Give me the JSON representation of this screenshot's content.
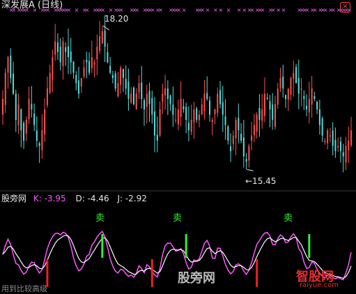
{
  "header": {
    "title": "深发展A (日线)"
  },
  "price_chart": {
    "high_label": "18.20",
    "low_label": "←15.45"
  },
  "indicator": {
    "name": "股旁网",
    "k": "K: -3.95",
    "d": "D: -4.46",
    "j": "J: -2.92",
    "sell_label": "卖"
  },
  "watermarks": {
    "center_text": "股旁网",
    "bottom_text": "用到比较高级",
    "logo_text": "智股网",
    "logo_url": "raiyue.com"
  },
  "colors": {
    "up": "#ff5050",
    "down": "#55dddd",
    "k_line": "#ff55ff",
    "d_line": "#ffffff",
    "sell_signal": "#33ee33",
    "buy_signal": "#ee2020",
    "marker": "#ff66ff"
  },
  "chart_data": [
    {
      "type": "candlestick",
      "title": "深发展A (日线)",
      "ylim": [
        15.2,
        18.4
      ],
      "annotations": [
        {
          "label": "18.20",
          "bar": 38,
          "value": 18.2
        },
        {
          "label": "15.45",
          "bar": 93,
          "value": 15.45
        }
      ],
      "closes": [
        16.8,
        17.3,
        17.6,
        17.2,
        16.9,
        16.4,
        16.7,
        16.2,
        16.0,
        16.4,
        16.8,
        16.6,
        16.3,
        16.0,
        15.9,
        16.2,
        16.6,
        17.0,
        17.3,
        17.6,
        17.9,
        17.7,
        17.5,
        17.9,
        17.7,
        17.6,
        17.5,
        17.3,
        17.1,
        16.9,
        17.2,
        17.4,
        17.5,
        17.3,
        17.6,
        17.5,
        17.8,
        18.0,
        18.1,
        17.8,
        17.5,
        17.3,
        17.2,
        17.0,
        17.1,
        17.4,
        17.2,
        17.0,
        16.8,
        16.9,
        16.7,
        16.9,
        17.1,
        16.8,
        16.6,
        16.9,
        16.7,
        16.5,
        16.1,
        16.0,
        16.6,
        16.9,
        17.0,
        16.8,
        16.7,
        16.5,
        16.4,
        16.6,
        16.8,
        16.6,
        16.4,
        16.2,
        16.4,
        16.6,
        16.4,
        16.5,
        16.7,
        16.9,
        16.8,
        16.5,
        16.4,
        16.6,
        16.9,
        16.7,
        16.5,
        16.3,
        16.0,
        15.8,
        16.1,
        16.4,
        16.2,
        16.0,
        15.7,
        15.6,
        15.9,
        16.1,
        16.3,
        16.5,
        16.4,
        16.6,
        16.9,
        16.8,
        16.6,
        16.4,
        16.7,
        17.0,
        17.2,
        17.0,
        16.8,
        17.0,
        17.2,
        17.3,
        17.1,
        16.9,
        17.0,
        16.8,
        16.6,
        16.8,
        17.0,
        16.8,
        16.6,
        16.3,
        16.1,
        16.0,
        16.2,
        16.1,
        15.9,
        15.8,
        15.9,
        15.8,
        15.7,
        15.9,
        16.0,
        16.2
      ]
    },
    {
      "type": "line",
      "title": "股旁网",
      "series": [
        {
          "name": "K",
          "value_label": "-3.95"
        },
        {
          "name": "D",
          "value_label": "-4.46"
        },
        {
          "name": "J",
          "value_label": "-2.92"
        }
      ],
      "sell_signals": [
        {
          "label": "卖",
          "bar": 38
        },
        {
          "label": "卖",
          "bar": 70
        },
        {
          "label": "卖",
          "bar": 117
        }
      ],
      "buy_signal_bars": [
        17,
        57,
        97,
        139
      ]
    }
  ]
}
